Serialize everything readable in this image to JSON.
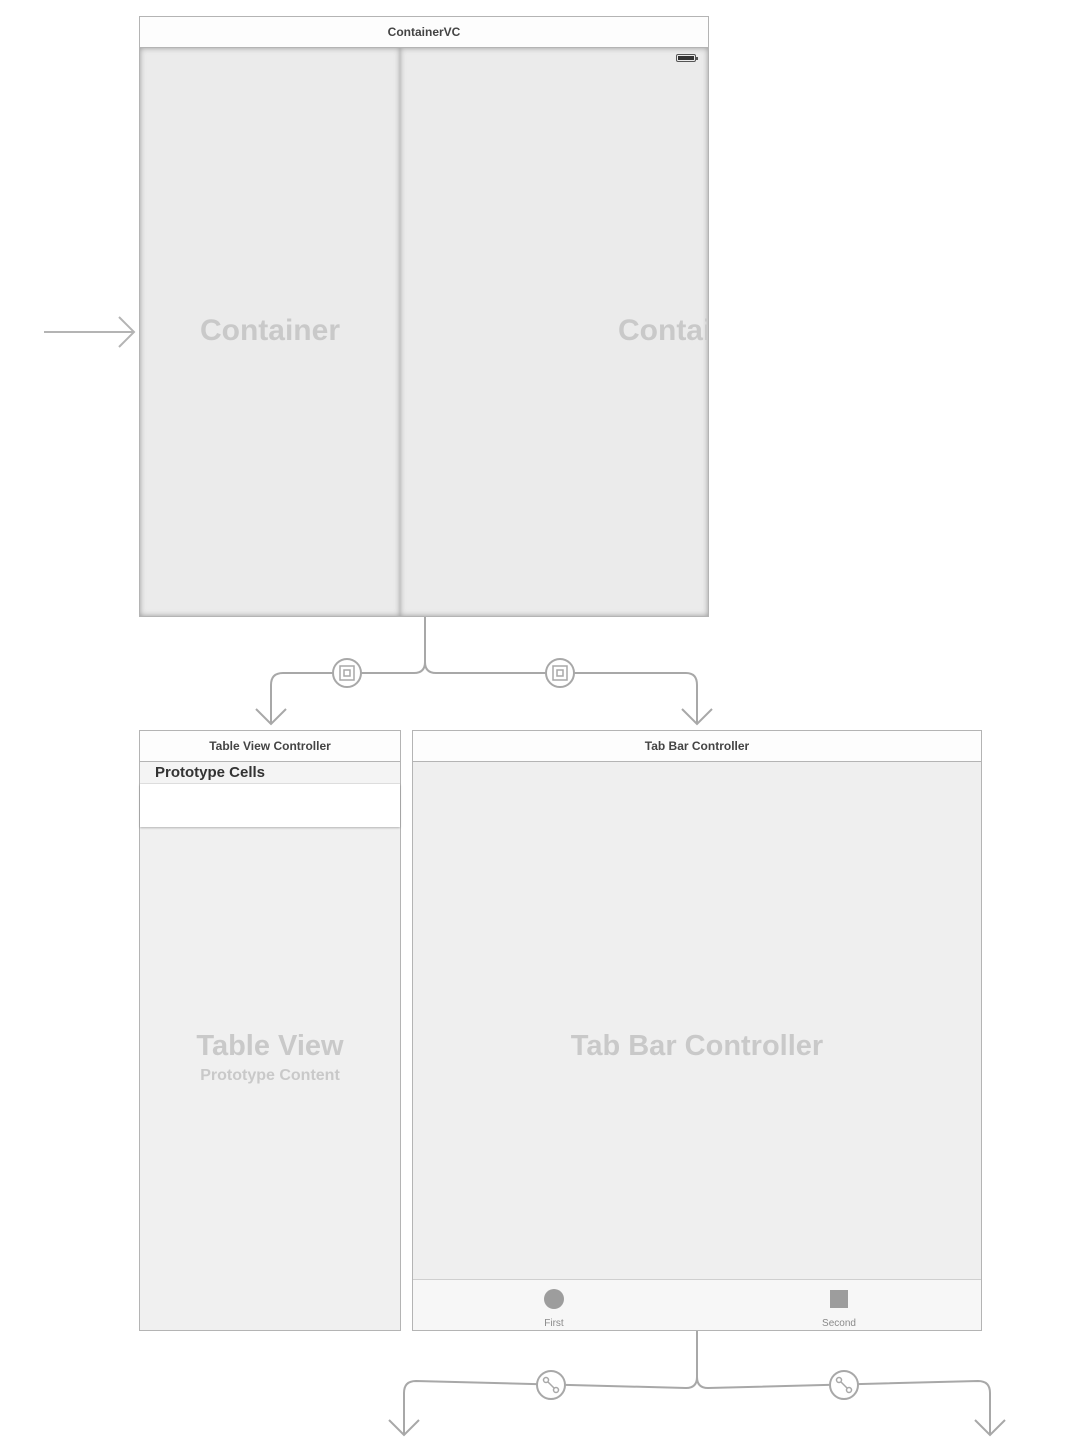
{
  "container_vc": {
    "title": "ContainerVC",
    "left_container_label": "Container",
    "right_container_label": "Contai"
  },
  "table_view_controller": {
    "title": "Table View Controller",
    "section_header": "Prototype Cells",
    "placeholder_title": "Table View",
    "placeholder_subtitle": "Prototype Content"
  },
  "tab_bar_controller": {
    "title": "Tab Bar Controller",
    "placeholder_title": "Tab Bar Controller",
    "tabs": [
      {
        "label": "First",
        "icon": "circle-icon"
      },
      {
        "label": "Second",
        "icon": "square-icon"
      }
    ]
  },
  "segues": {
    "embed_icon": "embed-segue-icon",
    "relationship_icon": "relationship-segue-icon",
    "entry_point_icon": "initial-view-controller-arrow"
  },
  "colors": {
    "canvas": "#ffffff",
    "scene_border": "#b4b4b4",
    "segue_line": "#a8a8a8",
    "placeholder_text": "#c9c9c9"
  }
}
